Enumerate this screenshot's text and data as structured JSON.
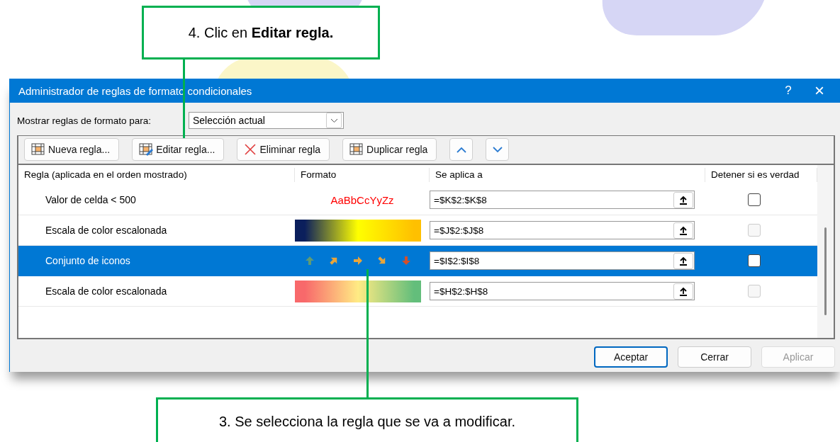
{
  "callout_top": {
    "text": "4. Clic en **Editar regla.**"
  },
  "dialog": {
    "title": "Administrador de reglas de formato condicionales",
    "help": "?",
    "close": "×",
    "show_rules_for": {
      "label": "Mostrar reglas de formato para:",
      "value": "Selección actual"
    },
    "toolbar": [
      {
        "kind": "new",
        "label": "Nueva regla..."
      },
      {
        "kind": "edit",
        "label": "Editar regla..."
      },
      {
        "kind": "delete",
        "label": "Eliminar regla"
      },
      {
        "kind": "duplicate",
        "label": "Duplicar regla"
      },
      {
        "kind": "up"
      },
      {
        "kind": "down"
      }
    ],
    "columns": [
      "Regla (aplicada en el orden mostrado)",
      "Formato",
      "Se aplica a",
      "Detener si es verdad"
    ],
    "rules": [
      {
        "name": "Valor de celda < 500",
        "format": {
          "kind": "text",
          "sample": "AaBbCcYyZz",
          "color": "#ff0000"
        },
        "applies_to": "=$K$2:$K$8",
        "stop_if_true": false,
        "stop_disabled": false,
        "selected": false
      },
      {
        "name": "Escala de color escalonada",
        "format": {
          "kind": "gradient",
          "stops": [
            {
              "color": "#0b1f5c"
            },
            {
              "color": "#ffff00"
            },
            {
              "color": "#ffc000"
            }
          ]
        },
        "applies_to": "=$J$2:$J$8",
        "stop_if_true": false,
        "stop_disabled": true,
        "selected": false
      },
      {
        "name": "Conjunto de iconos",
        "format": {
          "kind": "icons",
          "icons": [
            {
              "kind": "up",
              "color": "#5f9b74"
            },
            {
              "kind": "up-right",
              "color": "#e8a53a"
            },
            {
              "kind": "right",
              "color": "#e8a53a"
            },
            {
              "kind": "down-right",
              "color": "#e8a53a"
            },
            {
              "kind": "down",
              "color": "#d4502a"
            }
          ]
        },
        "applies_to": "=$I$2:$I$8",
        "stop_if_true": false,
        "stop_disabled": false,
        "selected": true
      },
      {
        "name": "Escala de color escalonada",
        "format": {
          "kind": "gradient",
          "stops": [
            {
              "color": "#f8696b"
            },
            {
              "color": "#ffeb84"
            },
            {
              "color": "#63be7b"
            }
          ]
        },
        "applies_to": "=$H$2:$H$8",
        "stop_if_true": false,
        "stop_disabled": true,
        "selected": false
      }
    ],
    "buttons": [
      {
        "label": "Aceptar",
        "default": true,
        "disabled": false
      },
      {
        "label": "Cerrar",
        "default": false,
        "disabled": false
      },
      {
        "label": "Aplicar",
        "default": false,
        "disabled": true
      }
    ]
  },
  "callout_bottom": {
    "text": "3. Se selecciona la regla que se va a modificar."
  }
}
